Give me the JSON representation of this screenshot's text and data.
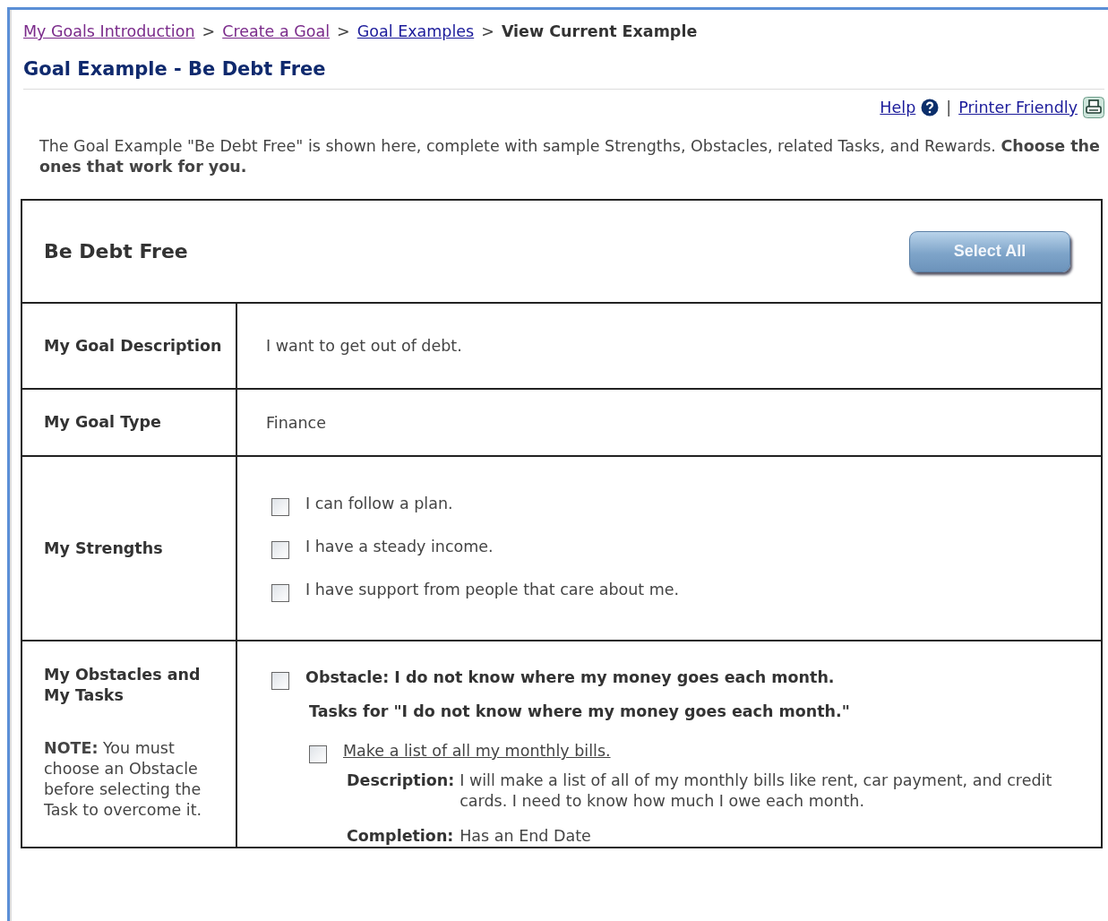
{
  "breadcrumb": {
    "links": [
      {
        "label": "My Goals Introduction",
        "visited": true
      },
      {
        "label": "Create a Goal",
        "visited": true
      },
      {
        "label": "Goal Examples",
        "visited": false
      }
    ],
    "separator": ">",
    "current": "View Current Example"
  },
  "page_title": "Goal Example - Be Debt Free",
  "tools": {
    "help": "Help",
    "divider": "|",
    "printer": "Printer Friendly"
  },
  "intro": "The Goal Example \"Be Debt Free\" is shown here, complete with sample Strengths, Obstacles, related Tasks, and Rewards. **Choose the ones that work for you.**",
  "goal": {
    "title": "Be Debt Free",
    "select_all": "Select All",
    "description_label": "My Goal Description",
    "description": "I want to get out of debt.",
    "type_label": "My Goal Type",
    "type": "Finance",
    "strengths_label": "My Strengths",
    "strengths": [
      {
        "text": "I can follow a plan.",
        "checked": false
      },
      {
        "text": "I have a steady income.",
        "checked": false
      },
      {
        "text": "I have support from people that care about me.",
        "checked": false
      }
    ],
    "obstacles_label": "My Obstacles and My Tasks",
    "obstacles_note": "**NOTE:** You must choose an Obstacle before selecting the Task to overcome it.",
    "obstacles": [
      {
        "text": "Obstacle: I do not know where my money goes each month.",
        "checked": false,
        "tasks_heading": "Tasks for \"I do not know where my money goes each month.\"",
        "tasks": [
          {
            "title": "Make a list of all my monthly bills.",
            "checked": false,
            "description_label": "Description:",
            "description": "I will make a list of all of my monthly bills like rent, car payment, and credit cards. I need to know how much I owe each month.",
            "completion_label": "Completion:",
            "completion": "Has an End Date"
          }
        ]
      }
    ]
  }
}
